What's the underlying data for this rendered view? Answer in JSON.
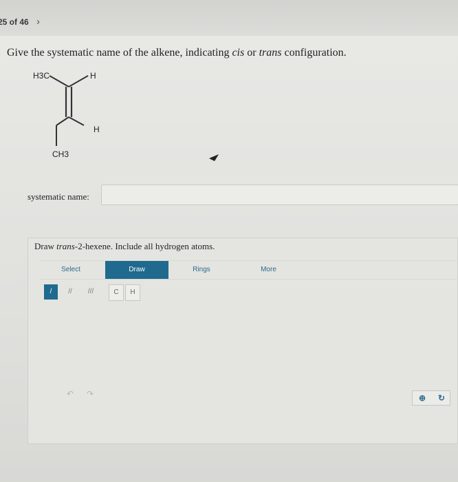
{
  "header": {
    "question_counter": "25 of 46",
    "next_symbol": "›"
  },
  "question": {
    "text_before": "Give the systematic name of the alkene, indicating ",
    "cis": "cis",
    "text_or": " or ",
    "trans": "trans",
    "text_after": " configuration."
  },
  "molecule": {
    "top_left_label": "H3C",
    "top_right_label": "H",
    "bottom_right_label": "H",
    "bottom_left_label": "CH3"
  },
  "answer": {
    "label": "systematic name:",
    "value": ""
  },
  "sketcher": {
    "prompt_before": "Draw ",
    "compound": "trans",
    "prompt_after": "-2-hexene. Include all hydrogen atoms.",
    "tabs": [
      "Select",
      "Draw",
      "Rings",
      "More"
    ],
    "active_tab": "Draw",
    "bond_tools": [
      "/",
      "//",
      "///"
    ],
    "atoms": [
      "C",
      "H"
    ],
    "undo_icon": "undo-icon",
    "redo_icon": "redo-icon",
    "zoom_icon": "zoom-icon",
    "rotate_icon": "rotate-icon"
  },
  "colors": {
    "accent": "#1f6a8e"
  }
}
